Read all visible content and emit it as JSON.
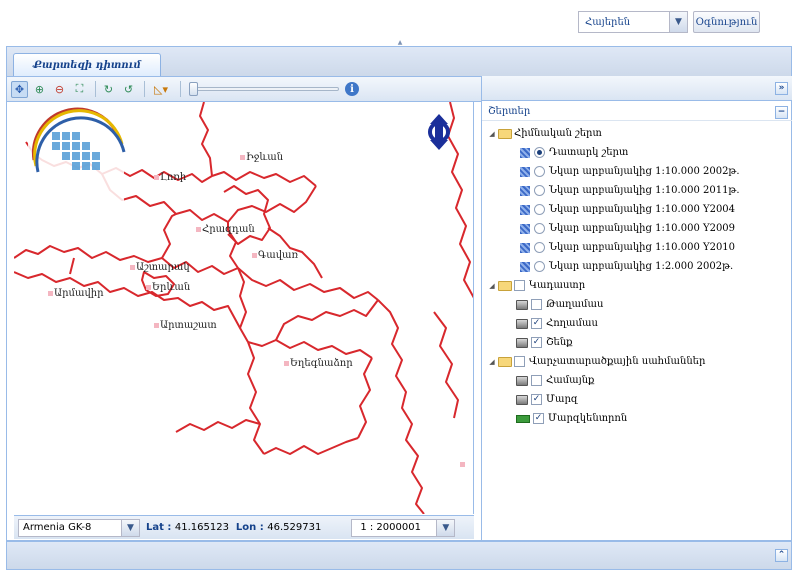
{
  "header": {
    "language_value": "Հայերեն",
    "help_label": "Օգնություն"
  },
  "tabs": [
    {
      "label": "Քարտեզի դիտում"
    }
  ],
  "map": {
    "cities": [
      {
        "name": "Լոռի"
      },
      {
        "name": "Իջևան"
      },
      {
        "name": "Ashtarak",
        "label": "Աշտարակ"
      }
    ]
  },
  "status": {
    "crs_value": "Armenia GK-8",
    "lat_label": "Lat :",
    "lat_value": "41.165123",
    "lon_label": "Lon :",
    "lon_value": "46.529731",
    "scale_value": "1 : 2000001"
  },
  "layers": {
    "title": "Շերտեր",
    "groups": [
      {
        "label": "Հիմնական շերտ"
      },
      {
        "label": "Կադաստր"
      },
      {
        "label": "Վարչատարածքային սահմաններ"
      }
    ],
    "base_items": [
      "Դատարկ շերտ",
      "Նկար արբանյակից 1:10.000 2002թ.",
      "Նկար արբանյակից 1:10.000 2011թ.",
      "Նկար արբանյակից 1:10.000 Y2004",
      "Նկար արբանյակից 1:10.000 Y2009",
      "Նկար արբանյակից 1:10.000 Y2010",
      "Նկար արբանյակից 1:2.000 2002թ."
    ],
    "cadastre_items": [
      "Թաղամաս",
      "Հողամաս",
      "Շենք"
    ],
    "admin_items": [
      "Համայնք",
      "Մարզ",
      "Մարզկենտրոն"
    ]
  }
}
